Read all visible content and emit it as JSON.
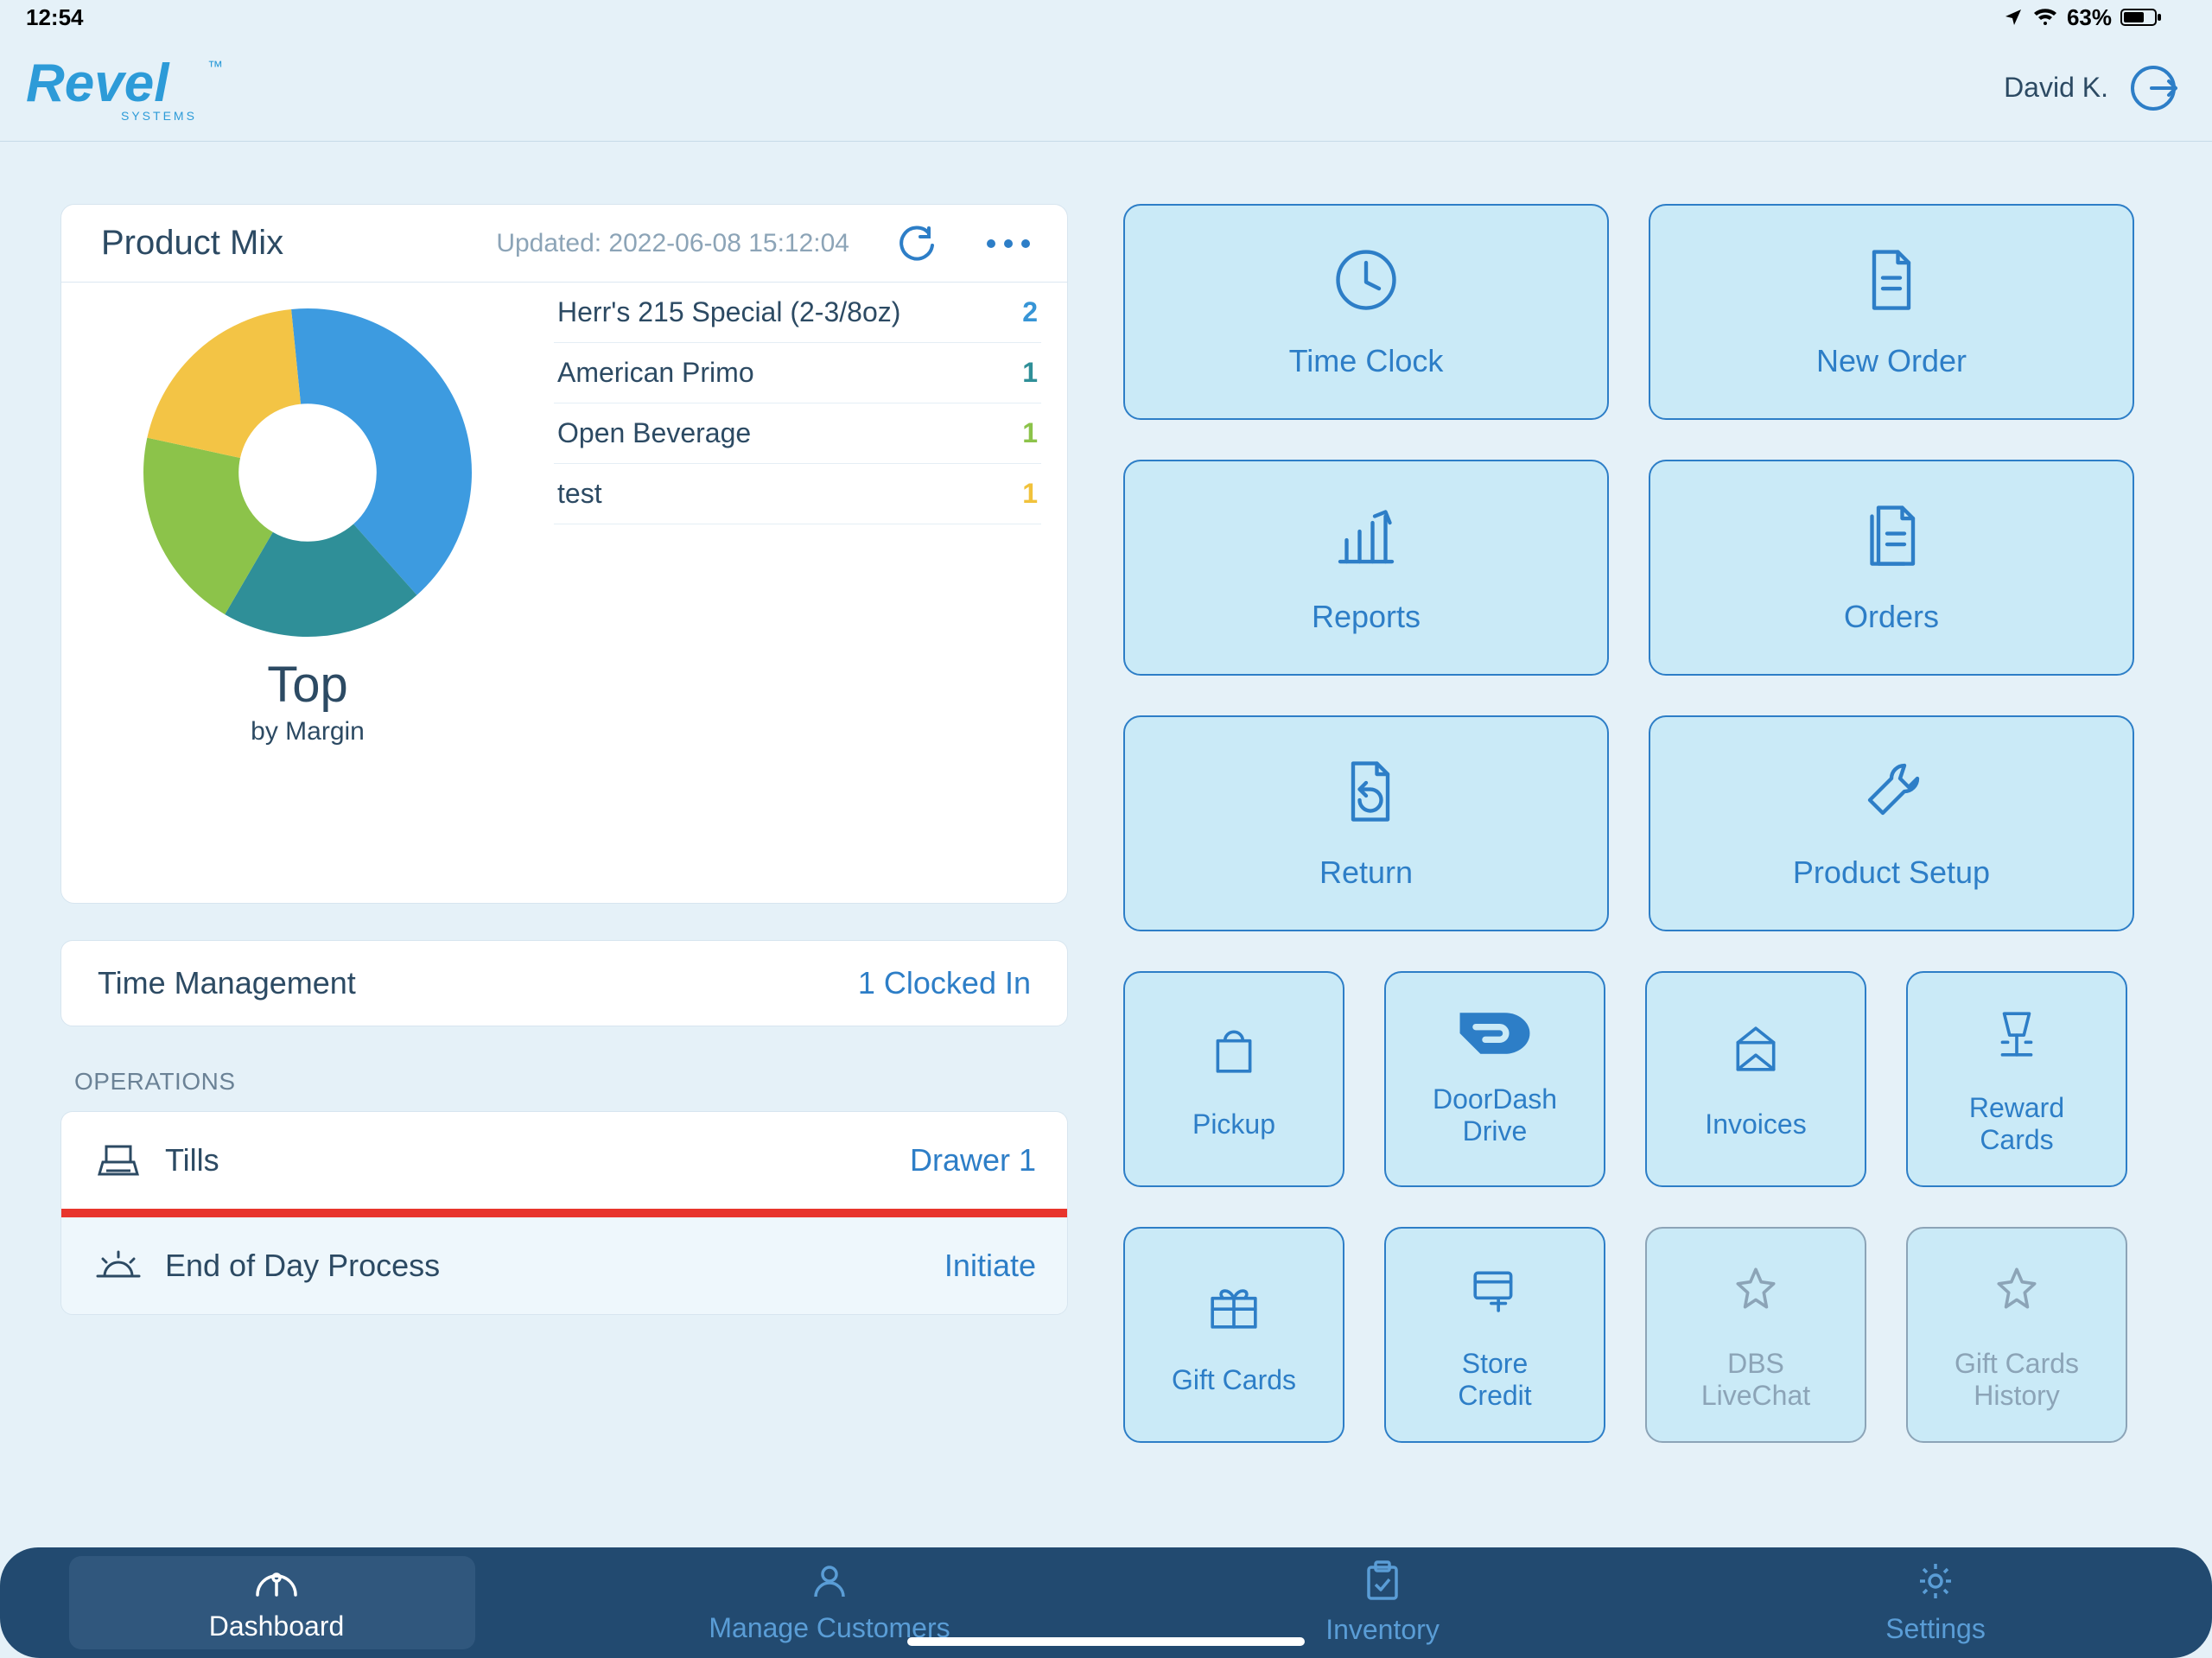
{
  "status": {
    "time": "12:54",
    "battery": "63%"
  },
  "header": {
    "brand_main": "Revel",
    "brand_tm": "™",
    "brand_sub": "SYSTEMS",
    "user": "David K."
  },
  "product_mix": {
    "title": "Product Mix",
    "updated": "Updated: 2022-06-08 15:12:04",
    "caption_big": "Top",
    "caption_sub": "by Margin",
    "items": [
      {
        "name": "Herr's 215 Special (2-3/8oz)",
        "count": "2",
        "cls": "cnt-blue"
      },
      {
        "name": "American Primo",
        "count": "1",
        "cls": "cnt-teal"
      },
      {
        "name": "Open Beverage",
        "count": "1",
        "cls": "cnt-green"
      },
      {
        "name": "test",
        "count": "1",
        "cls": "cnt-yellow"
      }
    ]
  },
  "chart_data": {
    "type": "pie",
    "title": "Product Mix — Top by Margin",
    "categories": [
      "Herr's 215 Special (2-3/8oz)",
      "American Primo",
      "Open Beverage",
      "test"
    ],
    "values": [
      2,
      1,
      1,
      1
    ],
    "colors": [
      "#3d9be0",
      "#2f8f98",
      "#8cc34a",
      "#f3c445"
    ],
    "inner_radius_ratio": 0.42
  },
  "time_mgmt": {
    "title": "Time Management",
    "status": "1 Clocked In"
  },
  "operations": {
    "heading": "OPERATIONS",
    "tills": {
      "label": "Tills",
      "value": "Drawer 1"
    },
    "eod": {
      "label": "End of Day Process",
      "value": "Initiate"
    }
  },
  "tiles": {
    "large": [
      {
        "key": "time-clock",
        "label": "Time Clock"
      },
      {
        "key": "new-order",
        "label": "New Order"
      },
      {
        "key": "reports",
        "label": "Reports"
      },
      {
        "key": "orders",
        "label": "Orders"
      },
      {
        "key": "return",
        "label": "Return"
      },
      {
        "key": "product-setup",
        "label": "Product Setup"
      }
    ],
    "small": [
      {
        "key": "pickup",
        "label": "Pickup"
      },
      {
        "key": "doordash-drive",
        "label": "DoorDash\nDrive"
      },
      {
        "key": "invoices",
        "label": "Invoices"
      },
      {
        "key": "reward-cards",
        "label": "Reward\nCards"
      },
      {
        "key": "gift-cards",
        "label": "Gift Cards"
      },
      {
        "key": "store-credit",
        "label": "Store\nCredit"
      },
      {
        "key": "dbs-livechat",
        "label": "DBS\nLiveChat",
        "grey": true
      },
      {
        "key": "gift-cards-history",
        "label": "Gift Cards\nHistory",
        "grey": true
      }
    ]
  },
  "nav": {
    "items": [
      {
        "key": "dashboard",
        "label": "Dashboard",
        "active": true
      },
      {
        "key": "manage-customers",
        "label": "Manage Customers"
      },
      {
        "key": "inventory",
        "label": "Inventory"
      },
      {
        "key": "settings",
        "label": "Settings"
      }
    ]
  }
}
